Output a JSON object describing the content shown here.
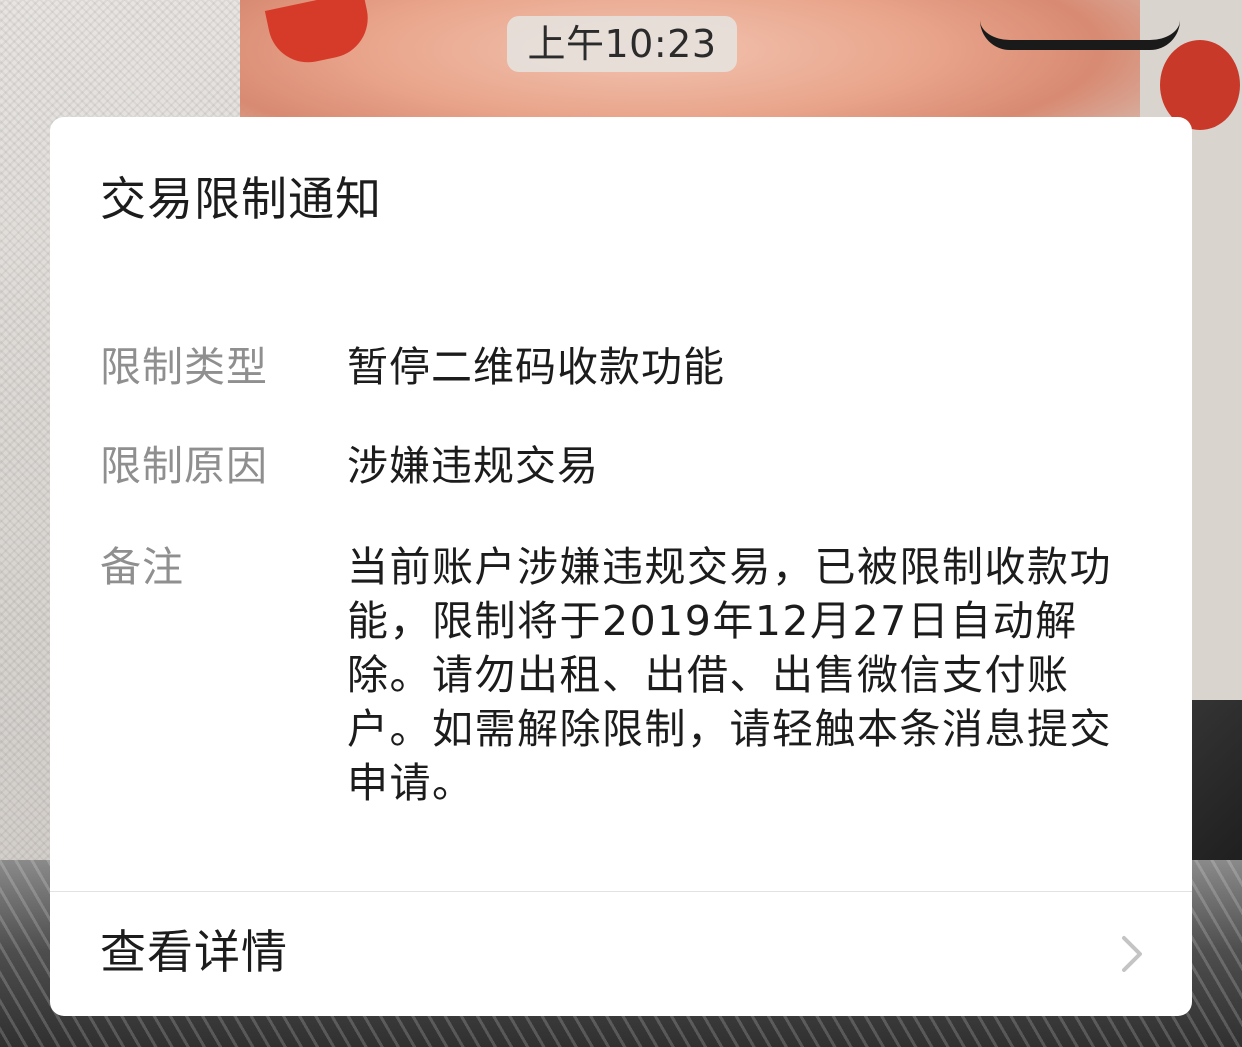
{
  "status_time": "上午10:23",
  "notification": {
    "title": "交易限制通知",
    "fields": [
      {
        "label": "限制类型",
        "value": "暂停二维码收款功能"
      },
      {
        "label": "限制原因",
        "value": "涉嫌违规交易"
      },
      {
        "label": "备注",
        "value": "当前账户涉嫌违规交易，已被限制收款功能，限制将于2019年12月27日自动解除。请勿出租、出借、出售微信支付账户。如需解除限制，请轻触本条消息提交申请。"
      }
    ],
    "action_label": "查看详情",
    "action_icon": "chevron-right-icon"
  }
}
